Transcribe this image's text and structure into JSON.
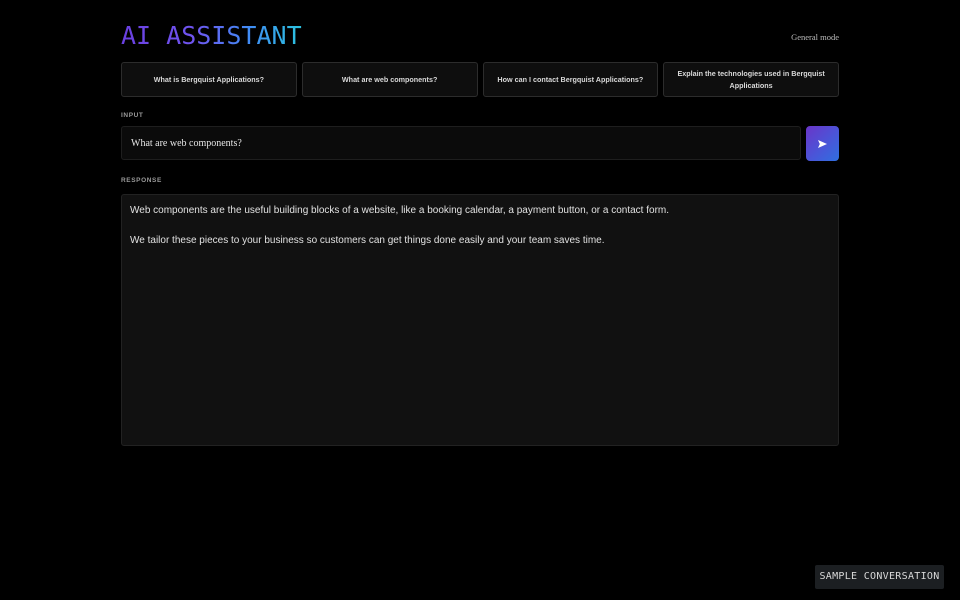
{
  "header": {
    "logo_text": "AI ASSISTANT",
    "mode_label": "General mode"
  },
  "suggestions": [
    {
      "label": "What is Bergquist Applications?"
    },
    {
      "label": "What are web components?"
    },
    {
      "label": "How can I contact Bergquist Applications?"
    },
    {
      "label": "Explain the technologies used in Bergquist Applications"
    }
  ],
  "input": {
    "section_label": "INPUT",
    "value": "What are web components?",
    "send_icon": "send-arrow-icon"
  },
  "response": {
    "section_label": "RESPONSE",
    "paragraphs": [
      "Web components are the useful building blocks of a website, like a booking calendar, a payment button, or a contact form.",
      "We tailor these pieces to your business so customers can get things done easily and your team saves time."
    ]
  },
  "footer": {
    "sample_label": "SAMPLE CONVERSATION"
  },
  "colors": {
    "background": "#000000",
    "panel": "#111111",
    "logo_gradient_start": "#6a3fe0",
    "logo_gradient_end": "#2bc4df",
    "send_button_start": "#6a35c8",
    "send_button_end": "#2f6fe0"
  }
}
